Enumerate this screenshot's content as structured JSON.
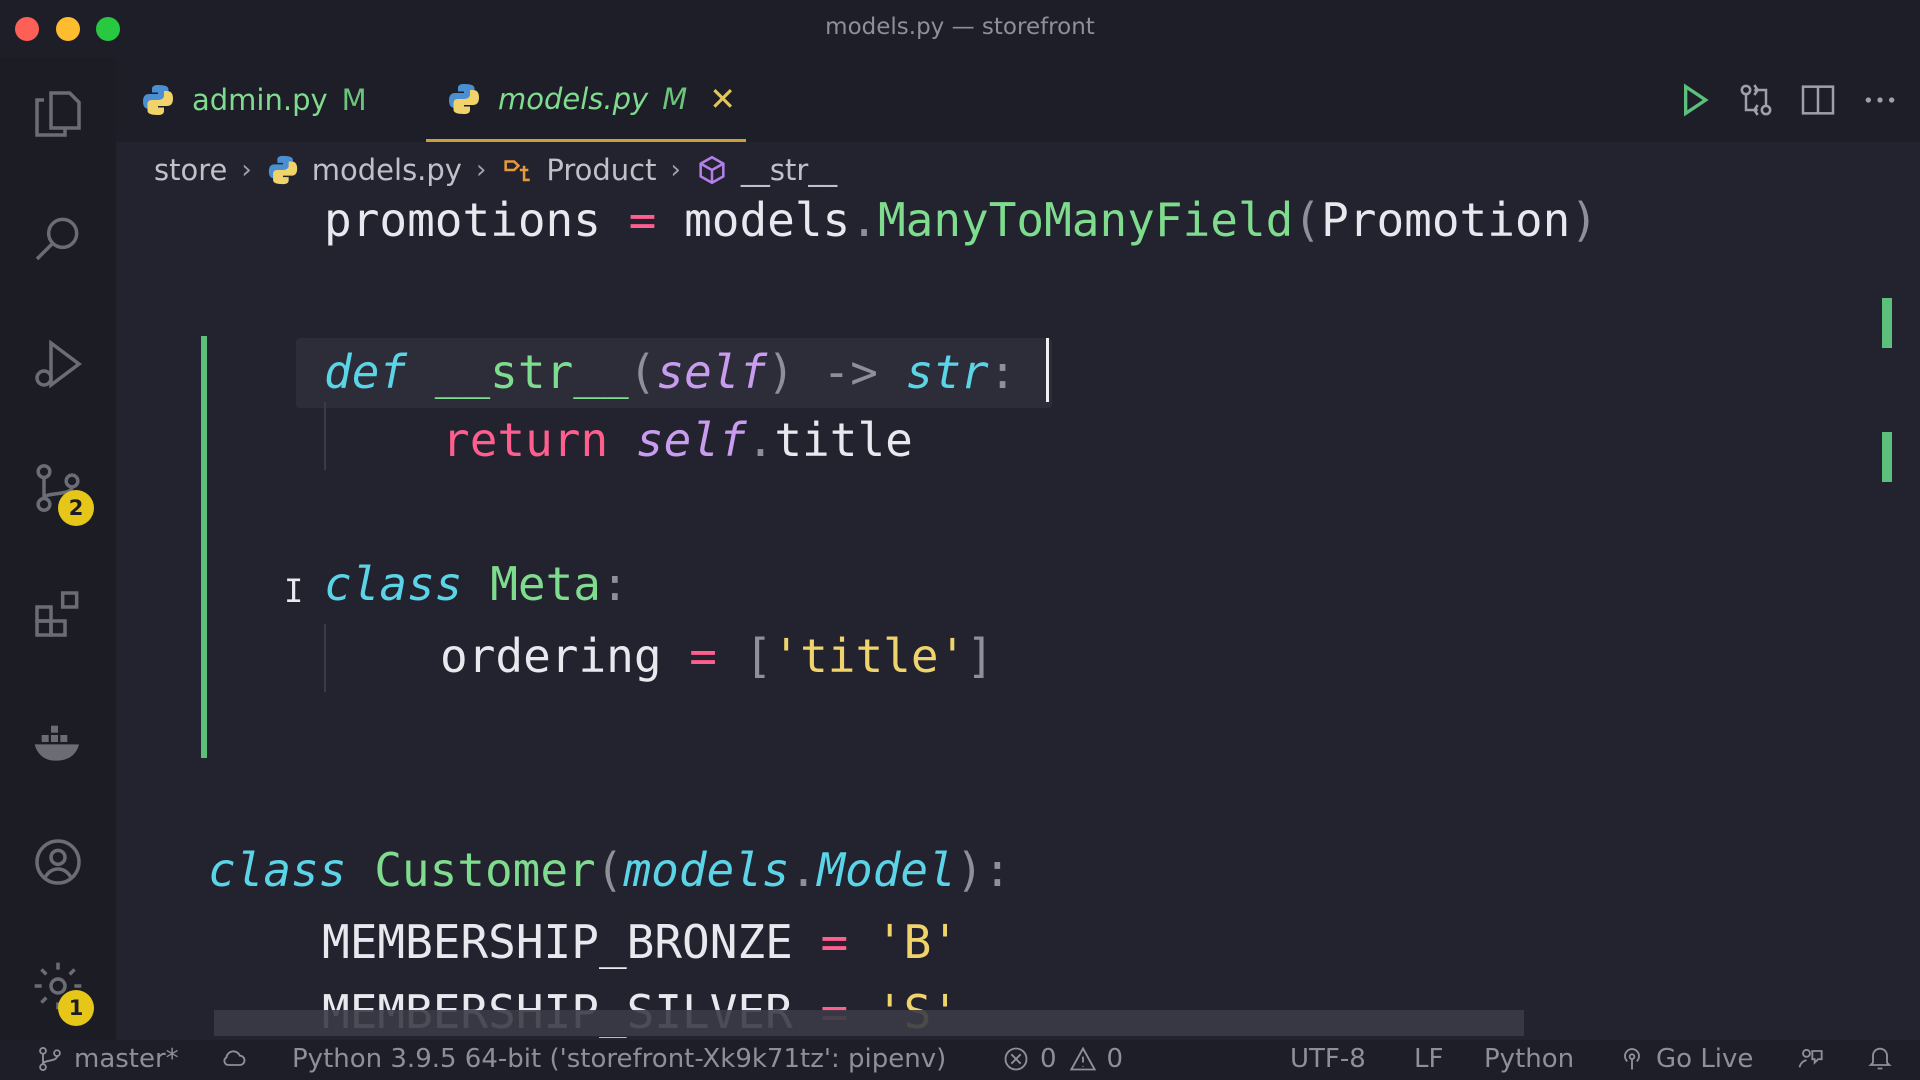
{
  "window": {
    "title": "models.py — storefront"
  },
  "activity_bar": {
    "source_control_badge": "2",
    "settings_badge": "1"
  },
  "tabs": [
    {
      "label": "admin.py",
      "status": "M"
    },
    {
      "label": "models.py",
      "status": "M",
      "close": "✕"
    }
  ],
  "breadcrumb": {
    "items": [
      "store",
      "models.py",
      "Product",
      "__str__"
    ],
    "separator": "›"
  },
  "code": {
    "line1": {
      "var": "promotions",
      "eq": "=",
      "obj": "models",
      "dot": ".",
      "call": "ManyToManyField",
      "lp": "(",
      "arg": "Promotion",
      "rp": ")"
    },
    "line2": {
      "def": "def",
      "name": "__str__",
      "lp": "(",
      "self": "self",
      "rp": ")",
      "arrow": "->",
      "ret": "str",
      "colon": ":"
    },
    "line3": {
      "return": "return",
      "self": "self",
      "dot": ".",
      "attr": "title"
    },
    "line4": {
      "class": "class",
      "name": "Meta",
      "colon": ":"
    },
    "line5": {
      "var": "ordering",
      "eq": "=",
      "lb": "[",
      "str": "'title'",
      "rb": "]"
    },
    "line6": {
      "class": "class",
      "name": "Customer",
      "lp": "(",
      "base_obj": "models",
      "dot": ".",
      "base": "Model",
      "rp": ")",
      "colon": ":"
    },
    "line7": {
      "var": "MEMBERSHIP_BRONZE",
      "eq": "=",
      "str": "'B'"
    },
    "line8": {
      "var": "MEMBERSHIP_SILVER",
      "eq": "=",
      "str": "'S'"
    }
  },
  "status_bar": {
    "branch": "master*",
    "interpreter": "Python 3.9.5 64-bit ('storefront-Xk9k71tz': pipenv)",
    "errors": "0",
    "warnings": "0",
    "encoding": "UTF-8",
    "eol": "LF",
    "language": "Python",
    "live": "Go Live"
  },
  "colors": {
    "accent_green": "#5cc07c",
    "badge_yellow": "#e6c619",
    "keyword": "#5ad4e6",
    "string": "#f1d36c",
    "operator": "#ff5e8e"
  }
}
